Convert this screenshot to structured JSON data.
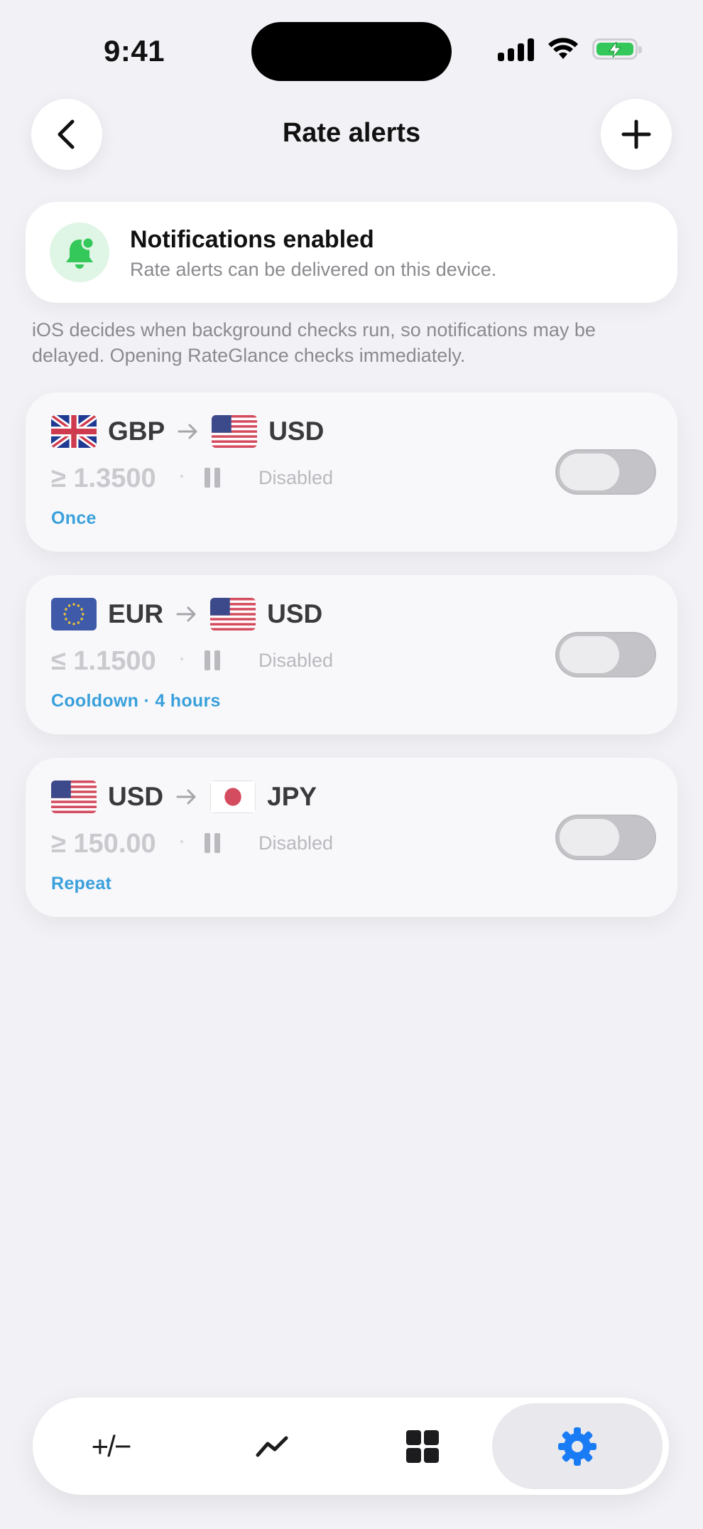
{
  "status_bar": {
    "time": "9:41"
  },
  "nav": {
    "title": "Rate alerts",
    "back_icon": "chevron-left-icon",
    "add_icon": "plus-icon"
  },
  "notifications": {
    "title": "Notifications enabled",
    "subtitle": "Rate alerts can be delivered on this device.",
    "footnote": "iOS decides when background checks run, so notifications may be delayed. Opening RateGlance checks immediately."
  },
  "alerts": [
    {
      "from": "GBP",
      "to": "USD",
      "from_flag": "uk-flag-icon",
      "to_flag": "us-flag-icon",
      "threshold": "≥ 1.3500",
      "state": "Disabled",
      "mode": "Once",
      "enabled": false
    },
    {
      "from": "EUR",
      "to": "USD",
      "from_flag": "eu-flag-icon",
      "to_flag": "us-flag-icon",
      "threshold": "≤ 1.1500",
      "state": "Disabled",
      "mode": "Cooldown · 4 hours",
      "enabled": false
    },
    {
      "from": "USD",
      "to": "JPY",
      "from_flag": "us-flag-icon",
      "to_flag": "japan-flag-icon",
      "threshold": "≥ 150.00",
      "state": "Disabled",
      "mode": "Repeat",
      "enabled": false
    }
  ],
  "tab_bar": {
    "tabs": [
      {
        "name": "convert",
        "icon": "plus-minus-icon",
        "glyph": "+/−"
      },
      {
        "name": "chart",
        "icon": "trend-chart-icon"
      },
      {
        "name": "widgets",
        "icon": "grid-icon"
      },
      {
        "name": "settings",
        "icon": "gear-icon",
        "selected": true
      }
    ],
    "accent": "#1a7cf5"
  },
  "colors": {
    "background": "#f2f2f6",
    "link": "#3aa0db",
    "success": "#34c759"
  }
}
